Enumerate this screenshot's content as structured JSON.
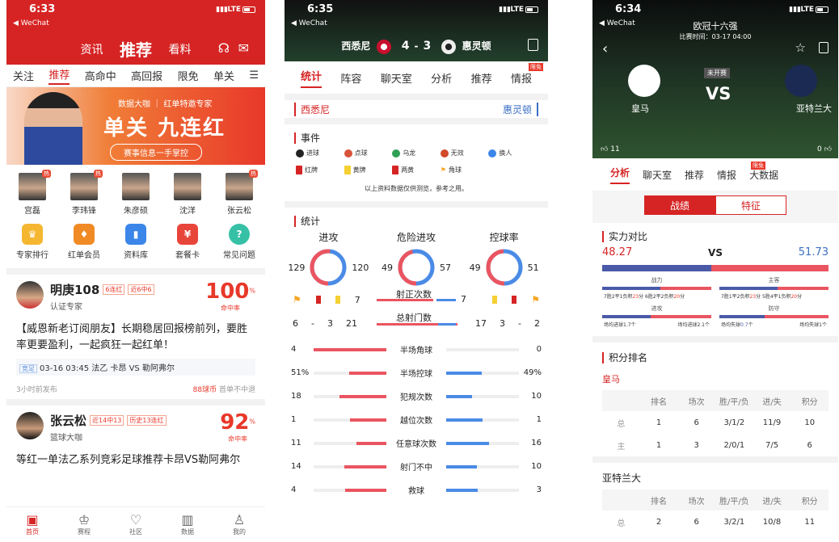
{
  "status": {
    "time1": "6:33",
    "time2": "6:35",
    "time3": "6:34",
    "wechat": "◀ WeChat",
    "lte": "LTE"
  },
  "s1": {
    "nav": [
      "资讯",
      "推荐",
      "看料"
    ],
    "tabs": [
      "关注",
      "推荐",
      "高命中",
      "高回报",
      "限免",
      "单关"
    ],
    "banner": {
      "sub": "数据大咖 ｜ 红单特邀专家",
      "big": "单关 九连红",
      "pill": "赛事信息一手掌控"
    },
    "experts": [
      {
        "name": "宫磊",
        "hot": true
      },
      {
        "name": "李玮锋",
        "hot": true
      },
      {
        "name": "朱彦硕",
        "hot": false
      },
      {
        "name": "沈洋",
        "hot": false
      },
      {
        "name": "张云松",
        "hot": true
      }
    ],
    "hot_label": "热",
    "quick": [
      {
        "label": "专家排行",
        "color": "#f5b731",
        "glyph": "♛"
      },
      {
        "label": "红单会员",
        "color": "#f08a24",
        "glyph": "♦"
      },
      {
        "label": "资料库",
        "color": "#3b86e8",
        "glyph": "▮"
      },
      {
        "label": "套餐卡",
        "color": "#e8453a",
        "glyph": "¥"
      },
      {
        "label": "常见问题",
        "color": "#36c1a6",
        "glyph": "?"
      }
    ],
    "posts": [
      {
        "name": "明庚108",
        "tag1": "6连红",
        "tag2": "近6中6",
        "role": "认证专家",
        "pct": "100",
        "pct_sup": "%",
        "pct_label": "命中率",
        "title": "【威恩新老订阅朋友】长期稳居回报榜前列，要胜率更要盈利，一起疯狂一起红单！",
        "match_tag": "竞足",
        "match": "03-16 03:45 法乙 卡昂 VS 勒阿弗尔",
        "time": "3小时前发布",
        "price": "88球币",
        "refund": "首单不中退"
      },
      {
        "name": "张云松",
        "tag1": "近14中13",
        "tag2": "历史13连红",
        "role": "篮球大咖",
        "pct": "92",
        "pct_sup": "%",
        "pct_label": "命中率",
        "title": "等红一单法乙系列竞彩足球推荐卡昂VS勒阿弗尔"
      }
    ],
    "bottom": [
      {
        "label": "首页",
        "glyph": "▣"
      },
      {
        "label": "赛程",
        "glyph": "♙"
      },
      {
        "label": "社区",
        "glyph": "♡"
      },
      {
        "label": "数据",
        "glyph": "▥"
      },
      {
        "label": "我的",
        "glyph": "♙"
      }
    ]
  },
  "s2": {
    "home": "西悉尼",
    "away": "惠灵顿",
    "score_h": "4",
    "dash": "-",
    "score_a": "3",
    "tabs": [
      "统计",
      "阵容",
      "聊天室",
      "分析",
      "推荐",
      "情报"
    ],
    "limit": "限免",
    "events_title": "事件",
    "legend": [
      {
        "label": "进球",
        "color": "#222",
        "shape": "dot"
      },
      {
        "label": "点球",
        "color": "#d9533a",
        "shape": "dot"
      },
      {
        "label": "乌龙",
        "color": "#2fa055",
        "shape": "dot"
      },
      {
        "label": "无效",
        "color": "#d14a2a",
        "shape": "dot"
      },
      {
        "label": "换人",
        "color": "#3b86e8",
        "shape": "dot"
      },
      {
        "label": "红牌",
        "color": "#d62424",
        "shape": "sq"
      },
      {
        "label": "黄牌",
        "color": "#f5d033",
        "shape": "sq"
      },
      {
        "label": "两黄",
        "color": "#d62424",
        "shape": "sq"
      },
      {
        "label": "角球",
        "color": "#f5a623",
        "shape": "flag"
      }
    ],
    "note": "以上资料数据仅供测览，参考之用。",
    "stats_title": "统计",
    "donuts": [
      {
        "label": "进攻",
        "home": 129,
        "away": 120
      },
      {
        "label": "危险进攻",
        "home": 49,
        "away": 57
      },
      {
        "label": "控球率",
        "home": 49,
        "away": 51
      }
    ],
    "cards": {
      "h_red": "7",
      "h_yel": "7",
      "shot_on": "射正次数",
      "sh_on_h": "7",
      "sh_on_a": "7",
      "corner_h": "6",
      "dash": "-",
      "red_h": "3",
      "shots_h": "21",
      "shots": "总射门数",
      "shots_a": "17",
      "yel_a": "3",
      "corner_a": "2"
    },
    "bars": [
      {
        "label": "半场角球",
        "h": "4",
        "a": "0",
        "hv": 4,
        "av": 0
      },
      {
        "label": "半场控球",
        "h": "51%",
        "a": "49%",
        "hv": 51,
        "av": 49
      },
      {
        "label": "犯规次数",
        "h": "18",
        "a": "10",
        "hv": 18,
        "av": 10
      },
      {
        "label": "越位次数",
        "h": "1",
        "a": "1",
        "hv": 1,
        "av": 1
      },
      {
        "label": "任意球次数",
        "h": "11",
        "a": "16",
        "hv": 11,
        "av": 16
      },
      {
        "label": "射门不中",
        "h": "14",
        "a": "10",
        "hv": 14,
        "av": 10
      },
      {
        "label": "救球",
        "h": "4",
        "a": "3",
        "hv": 4,
        "av": 3
      }
    ]
  },
  "s3": {
    "title": "欧冠十六强",
    "subtitle": "比赛时间：03-17 04:00",
    "home": "皇马",
    "away": "亚特兰大",
    "vs": "VS",
    "status": "未开赛",
    "likes_h": "11",
    "likes_a": "0",
    "tabs": [
      "分析",
      "聊天室",
      "推荐",
      "情报",
      "大数据"
    ],
    "limit": "限免",
    "seg": [
      "战绩",
      "特征"
    ],
    "power_title": "实力对比",
    "power_h": "48.27",
    "power_vs": "VS",
    "power_a": "51.73",
    "power_hv": 48.27,
    "power_av": 51.73,
    "blocks": [
      {
        "label": "战力",
        "rl": "7胜2平1负积",
        "rln": "23",
        "rm": "分 6胜2平2负积",
        "rrn": "20",
        "rr": "分",
        "hv": 23,
        "av": 20
      },
      {
        "label": "主客",
        "rl": "7胜1平2负积",
        "rln": "23",
        "rm": "分 5胜4平1负积",
        "rrn": "20",
        "rr": "分",
        "hv": 23,
        "av": 20
      }
    ],
    "blocks2": [
      {
        "label": "进攻",
        "left": "场均进球1.7个",
        "right": "场均进球2.1个",
        "hv": 1.7,
        "av": 2.1
      },
      {
        "label": "防守",
        "left": "场均失球",
        "leftn": "0.7",
        "leftu": "个",
        "right": "场均失球1个",
        "hv": 0.7,
        "av": 1
      }
    ],
    "rank_title": "积分排名",
    "team1": "皇马",
    "team2": "亚特兰大",
    "headers": [
      "",
      "排名",
      "场次",
      "胜/平/负",
      "进/失",
      "积分"
    ],
    "rows1": [
      [
        "总",
        "1",
        "6",
        "3/1/2",
        "11/9",
        "10"
      ],
      [
        "主",
        "1",
        "3",
        "2/0/1",
        "7/5",
        "6"
      ]
    ],
    "rows2": [
      [
        "总",
        "2",
        "6",
        "3/2/1",
        "10/8",
        "11"
      ]
    ]
  }
}
